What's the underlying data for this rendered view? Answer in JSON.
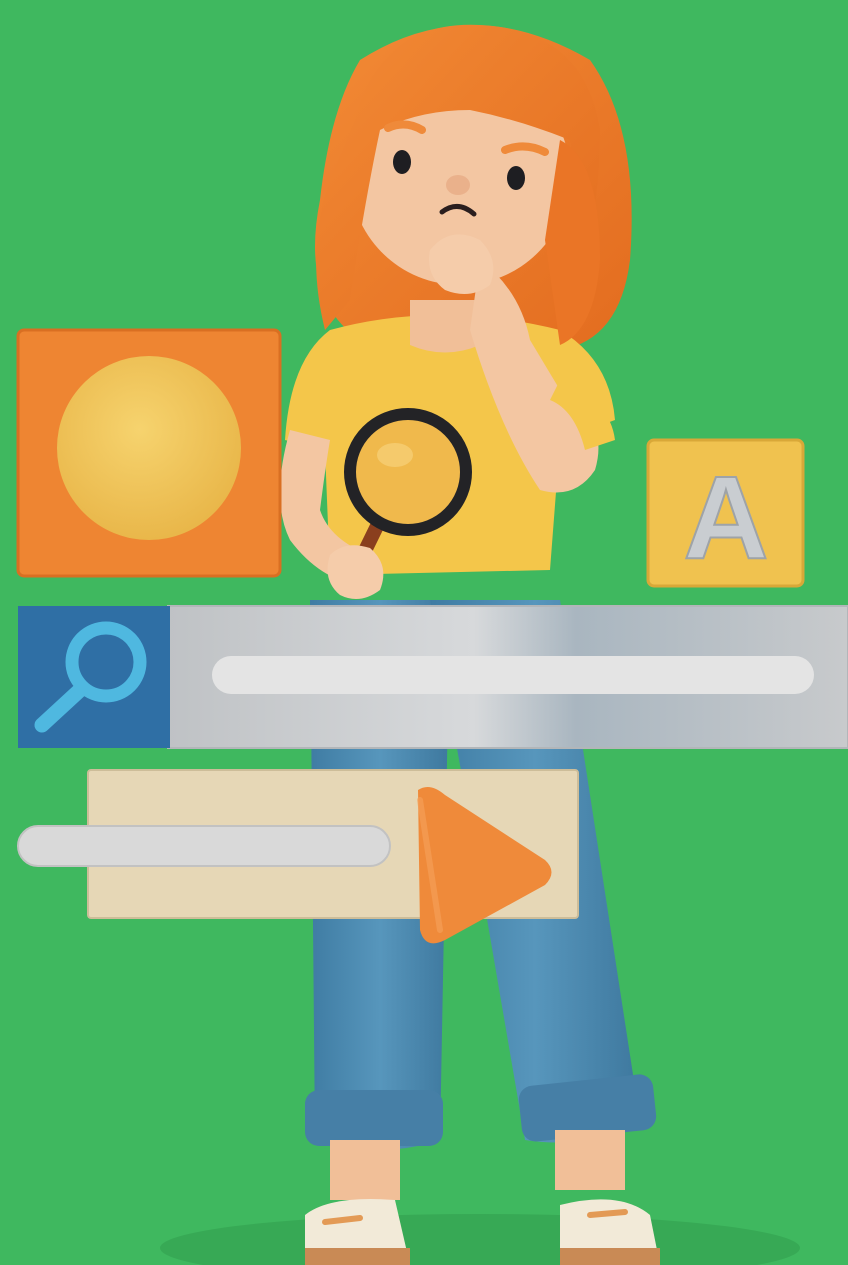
{
  "scene": {
    "description_tags": [
      "3d-illustration",
      "search-concept"
    ],
    "colors": {
      "background": "#3fb85f",
      "hair": "#ee7a2a",
      "skin": "#f3c6a2",
      "shirt": "#f4c64a",
      "jeans": "#4f8fb6",
      "orange_tile": "#ee8532",
      "yellow_circle": "#f1c75a",
      "letter_tile": "#f0c24f",
      "search_button": "#2f6fa5",
      "search_icon": "#4fb8e0",
      "search_bar": "#c4c7ca",
      "search_track": "#e4e4e4",
      "media_panel": "#e6d7b6",
      "play_cone": "#ef8a3a",
      "shoe": "#f2ead8"
    }
  },
  "letter_tile": {
    "letter": "A"
  },
  "icons": {
    "search": "search-icon",
    "magnifier": "magnifying-glass-icon",
    "play": "play-cone-icon"
  }
}
